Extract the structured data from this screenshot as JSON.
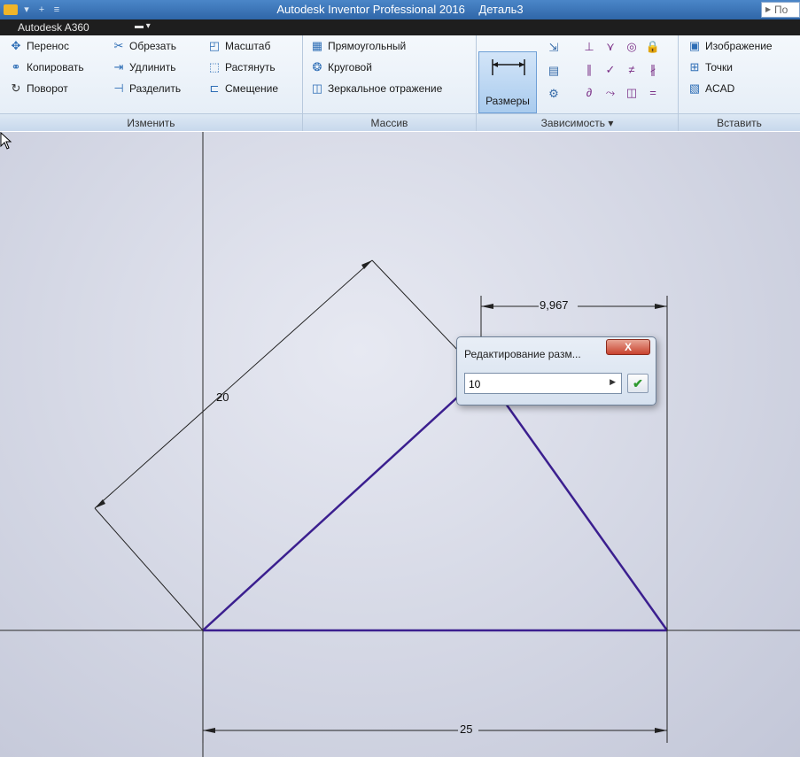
{
  "titlebar": {
    "app_title": "Autodesk Inventor Professional 2016",
    "document": "Деталь3",
    "search_placeholder": "По"
  },
  "tabs": {
    "a360": "Autodesk A360",
    "media": "▬ ▾"
  },
  "ribbon": {
    "modify": {
      "label": "Изменить",
      "move": "Перенос",
      "copy": "Копировать",
      "rotate": "Поворот",
      "trim": "Обрезать",
      "extend": "Удлинить",
      "split": "Разделить",
      "scale": "Масштаб",
      "stretch": "Растянуть",
      "offset": "Смещение"
    },
    "pattern": {
      "label": "Массив",
      "rectangular": "Прямоугольный",
      "circular": "Круговой",
      "mirror": "Зеркальное отражение"
    },
    "constrain": {
      "label": "Зависимость ▾",
      "dimension": "Размеры"
    },
    "insert": {
      "label": "Вставить",
      "image": "Изображение",
      "points": "Точки",
      "acad": "ACAD"
    }
  },
  "canvas": {
    "dim_slanted": "20",
    "dim_top": "9,967",
    "dim_base": "25"
  },
  "dialog": {
    "title": "Редактирование разм...",
    "close": "X",
    "value": "10",
    "ok": "✔"
  },
  "colors": {
    "sketch_line": "#3b1f8f",
    "dimension_line": "#111111",
    "titlebar": "#3a73b6"
  }
}
